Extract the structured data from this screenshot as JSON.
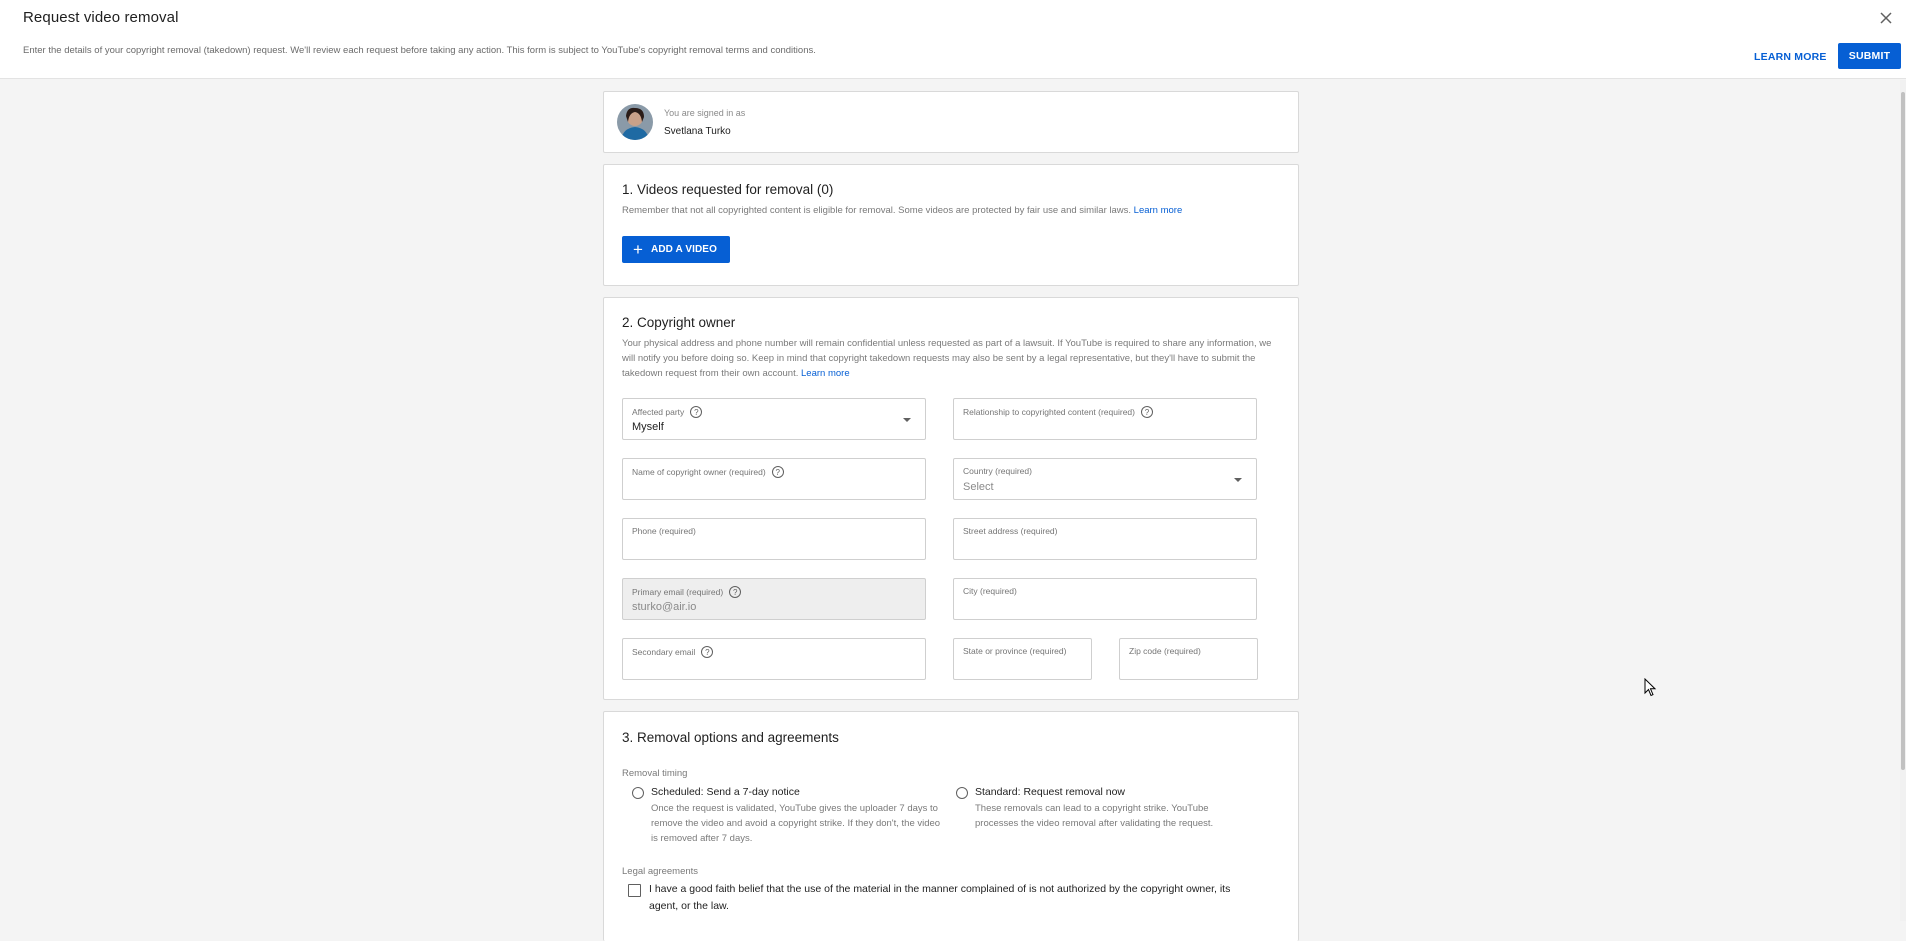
{
  "header": {
    "title": "Request video removal",
    "description": "Enter the details of your copyright removal (takedown) request. We'll review each request before taking any action. This form is subject to YouTube's copyright removal terms and conditions.",
    "learn_more_label": "LEARN MORE",
    "submit_label": "SUBMIT",
    "close_icon": "close-icon"
  },
  "account": {
    "signed_in_label": "You are signed in as",
    "name": "Svetlana Turko"
  },
  "section1": {
    "title": "1. Videos requested for removal (0)",
    "description": "Remember that not all copyrighted content is eligible for removal. Some videos are protected by fair use and similar laws.",
    "link": "Learn more",
    "add_video_label": "ADD A VIDEO",
    "video_count": 0
  },
  "section2": {
    "title": "2. Copyright owner",
    "description": "Your physical address and phone number will remain confidential unless requested as part of a lawsuit. If YouTube is required to share any information, we will notify you before doing so. Keep in mind that copyright takedown requests may also be sent by a legal representative, but they'll have to submit the takedown request from their own account.",
    "link": "Learn more",
    "fields": {
      "affected_party": {
        "label": "Affected party",
        "value": "Myself"
      },
      "relationship": {
        "label": "Relationship to copyrighted content (required)",
        "value": ""
      },
      "owner_name": {
        "label": "Name of copyright owner (required)",
        "value": ""
      },
      "country": {
        "label": "Country (required)",
        "value": "Select"
      },
      "phone": {
        "label": "Phone (required)",
        "value": ""
      },
      "street": {
        "label": "Street address (required)",
        "value": ""
      },
      "primary_email": {
        "label": "Primary email (required)",
        "value": "sturko@air.io"
      },
      "city": {
        "label": "City (required)",
        "value": ""
      },
      "secondary_email": {
        "label": "Secondary email",
        "value": ""
      },
      "state": {
        "label": "State or province (required)",
        "value": ""
      },
      "zip": {
        "label": "Zip code (required)",
        "value": ""
      }
    }
  },
  "section3": {
    "title": "3. Removal options and agreements",
    "timing_label": "Removal timing",
    "options": [
      {
        "label": "Scheduled: Send a 7-day notice",
        "description": "Once the request is validated, YouTube gives the uploader 7 days to remove the video and avoid a copyright strike. If they don't, the video is removed after 7 days.",
        "selected": false
      },
      {
        "label": "Standard: Request removal now",
        "description": "These removals can lead to a copyright strike. YouTube processes the video removal after validating the request.",
        "selected": false
      }
    ],
    "legal_label": "Legal agreements",
    "agreements": [
      {
        "label": "I have a good faith belief that the use of the material in the manner complained of is not authorized by the copyright owner, its agent, or the law.",
        "checked": false
      }
    ]
  },
  "colors": {
    "accent": "#065fd4",
    "background": "#f4f4f4"
  }
}
